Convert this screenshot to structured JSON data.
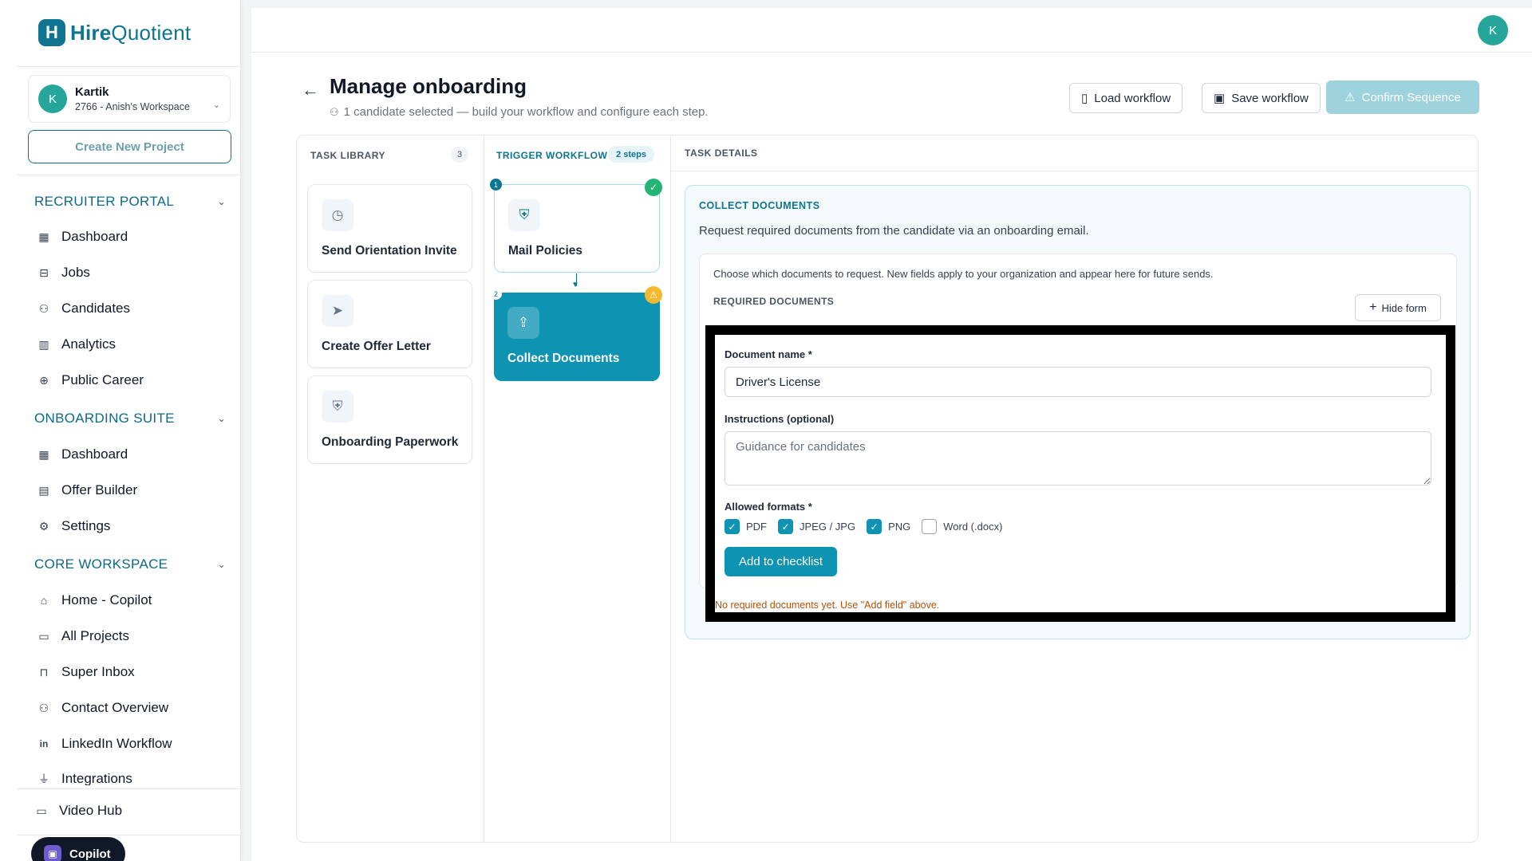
{
  "brand": {
    "name_bold": "Hire",
    "name_rest": "Quotient",
    "logo_letter": "H"
  },
  "workspace": {
    "avatar": "K",
    "name": "Kartik",
    "sub": "2766 - Anish's Workspace"
  },
  "sidebar": {
    "create_project": "Create New Project",
    "sections": [
      {
        "title": "RECRUITER PORTAL",
        "items": [
          {
            "label": "Dashboard",
            "icon": "grid-icon"
          },
          {
            "label": "Jobs",
            "icon": "briefcase-icon"
          },
          {
            "label": "Candidates",
            "icon": "users-icon"
          },
          {
            "label": "Analytics",
            "icon": "bar-chart-icon"
          },
          {
            "label": "Public Career",
            "icon": "globe-icon"
          }
        ]
      },
      {
        "title": "ONBOARDING SUITE",
        "items": [
          {
            "label": "Dashboard",
            "icon": "grid-icon"
          },
          {
            "label": "Offer Builder",
            "icon": "document-icon"
          },
          {
            "label": "Settings",
            "icon": "gear-icon"
          }
        ]
      },
      {
        "title": "CORE WORKSPACE",
        "items": [
          {
            "label": "Home - Copilot",
            "icon": "home-icon"
          },
          {
            "label": "All Projects",
            "icon": "folder-icon"
          },
          {
            "label": "Super Inbox",
            "icon": "inbox-icon"
          },
          {
            "label": "Contact Overview",
            "icon": "users-icon"
          },
          {
            "label": "LinkedIn Workflow",
            "icon": "linkedin-icon"
          },
          {
            "label": "Integrations",
            "icon": "plug-icon"
          }
        ]
      }
    ],
    "video_hub": "Video Hub",
    "copilot": "Copilot"
  },
  "topbar": {
    "avatar": "K"
  },
  "header": {
    "title": "Manage onboarding",
    "subtitle": "1 candidate selected — build your workflow and configure each step.",
    "load_workflow": "Load workflow",
    "save_workflow": "Save workflow",
    "confirm_sequence": "Confirm Sequence"
  },
  "task_library": {
    "heading": "TASK LIBRARY",
    "count": "3",
    "items": [
      {
        "label": "Send Orientation Invite",
        "icon": "calendar-clock-icon"
      },
      {
        "label": "Create Offer Letter",
        "icon": "send-icon"
      },
      {
        "label": "Onboarding Paperwork",
        "icon": "shield-icon"
      }
    ]
  },
  "trigger_workflow": {
    "heading": "TRIGGER WORKFLOW",
    "steps_badge": "2 steps",
    "steps": [
      {
        "num": "1",
        "label": "Mail Policies",
        "icon": "shield-check-icon",
        "status": "complete"
      },
      {
        "num": "2",
        "label": "Collect Documents",
        "icon": "upload-icon",
        "status": "warning"
      }
    ]
  },
  "task_details": {
    "heading": "TASK DETAILS",
    "panel_title": "COLLECT DOCUMENTS",
    "panel_desc": "Request required documents from the candidate via an onboarding email.",
    "helper": "Choose which documents to request. New fields apply to your organization and appear here for future sends.",
    "required_heading": "REQUIRED DOCUMENTS",
    "hide_form": "Hide form",
    "form": {
      "doc_name_label": "Document name *",
      "doc_name_value": "Driver's License",
      "instructions_label": "Instructions (optional)",
      "instructions_placeholder": "Guidance for candidates",
      "formats_label": "Allowed formats *",
      "formats": [
        {
          "label": "PDF",
          "checked": true
        },
        {
          "label": "JPEG / JPG",
          "checked": true
        },
        {
          "label": "PNG",
          "checked": true
        },
        {
          "label": "Word (.docx)",
          "checked": false
        }
      ],
      "add_button": "Add to checklist"
    },
    "empty_warning": "No required documents yet. Use \"Add field\" above."
  },
  "colors": {
    "accent": "#0e93b3",
    "brand": "#0e7490",
    "success": "#22b573",
    "warning": "#f5b82e"
  }
}
